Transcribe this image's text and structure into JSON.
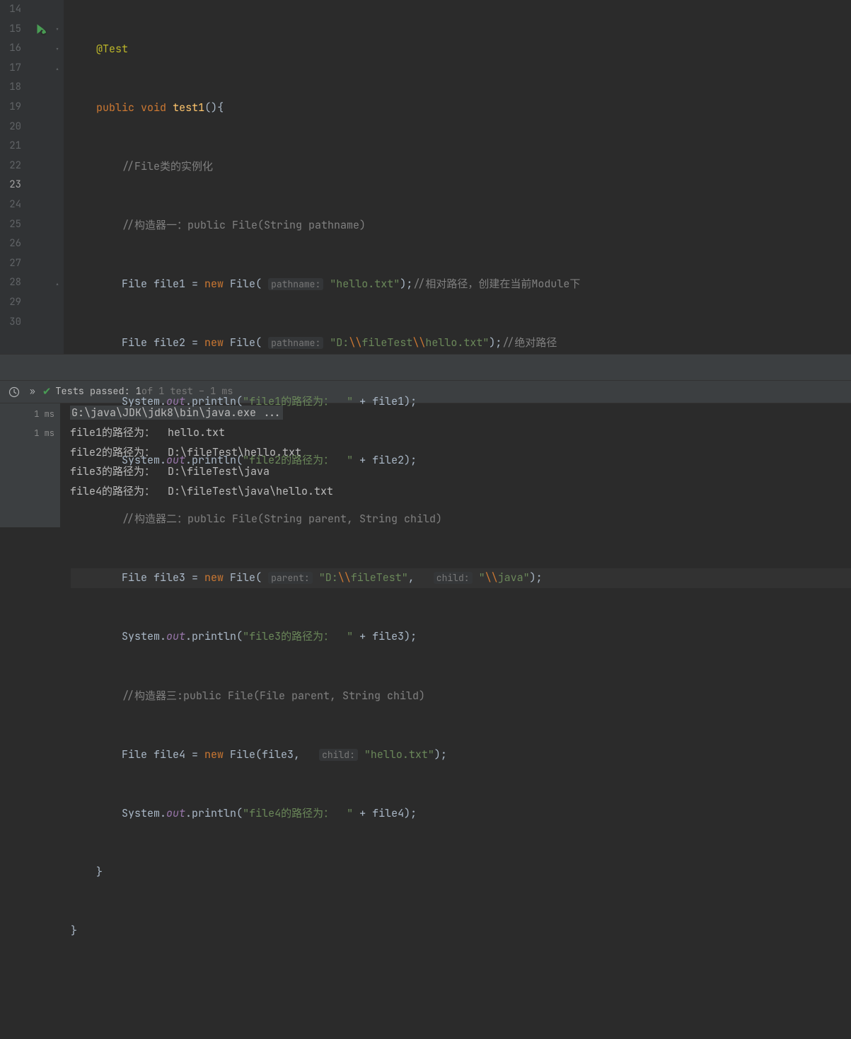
{
  "editor": {
    "line_numbers": [
      "14",
      "15",
      "16",
      "17",
      "18",
      "19",
      "20",
      "21",
      "22",
      "23",
      "24",
      "25",
      "26",
      "27",
      "28",
      "29",
      "30"
    ],
    "current_line": "23",
    "code": {
      "l14": {
        "annotation": "@Test"
      },
      "l15": {
        "kw1": "public",
        "kw2": "void",
        "method": "test1",
        "tail": "(){"
      },
      "l16": {
        "comment": "//File类的实例化"
      },
      "l17": {
        "comment": "//构造器一：public File(String pathname)"
      },
      "l18": {
        "t1": "File file1 = ",
        "kw_new": "new",
        "t2": " File(",
        "hint": "pathname:",
        "str": "\"hello.txt\"",
        "t3": ");",
        "cmt": "//相对路径，创建在当前Module下"
      },
      "l19": {
        "t1": "File file2 = ",
        "kw_new": "new",
        "t2": " File(",
        "hint": "pathname:",
        "str_p1": "\"D:",
        "esc1": "\\\\",
        "str_p2": "fileTest",
        "esc2": "\\\\",
        "str_p3": "hello.txt\"",
        "t3": ");",
        "cmt": "//绝对路径"
      },
      "l20": {
        "t1": "System.",
        "field": "out",
        "t2": ".println(",
        "str": "\"file1的路径为：  \"",
        "t3": " + file1);"
      },
      "l21": {
        "t1": "System.",
        "field": "out",
        "t2": ".println(",
        "str": "\"file2的路径为：  \"",
        "t3": " + file2);"
      },
      "l22": {
        "comment": "//构造器二：public File(String parent, String child)"
      },
      "l23": {
        "t1": "File file3 = ",
        "kw_new": "new",
        "t2": " File(",
        "hint1": "parent:",
        "str1_p1": "\"D:",
        "esc1": "\\\\",
        "str1_p2": "fileTest\"",
        "comma": ",  ",
        "hint2": "child:",
        "str2_p1": "\"",
        "esc2": "\\\\",
        "str2_p2": "java\"",
        "t3": ");"
      },
      "l24": {
        "t1": "System.",
        "field": "out",
        "t2": ".println(",
        "str": "\"file3的路径为：  \"",
        "t3": " + file3);"
      },
      "l25": {
        "comment": "//构造器三:public File(File parent, String child)"
      },
      "l26": {
        "t1": "File file4 = ",
        "kw_new": "new",
        "t2": " File(file3,  ",
        "hint": "child:",
        "str": "\"hello.txt\"",
        "t3": ");"
      },
      "l27": {
        "t1": "System.",
        "field": "out",
        "t2": ".println(",
        "str": "\"file4的路径为：  \"",
        "t3": " + file4);"
      },
      "l28": {
        "brace": "}"
      },
      "l29": {
        "brace": "}"
      }
    }
  },
  "test_status": {
    "passed_label": "Tests passed: 1",
    "total_label": " of 1 test – 1 ms"
  },
  "output_sidebar": {
    "ms1": "1 ms",
    "ms2": "1 ms"
  },
  "console": {
    "cmd": "G:\\java\\JDK\\jdk8\\bin\\java.exe ...",
    "line1": "file1的路径为：  hello.txt",
    "line2": "file2的路径为：  D:\\fileTest\\hello.txt",
    "line3": "file3的路径为：  D:\\fileTest\\java",
    "line4": "file4的路径为：  D:\\fileTest\\java\\hello.txt"
  }
}
